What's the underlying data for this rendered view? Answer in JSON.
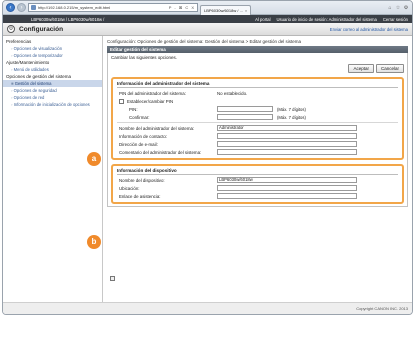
{
  "browser": {
    "back_icon": "back-arrow-icon",
    "forward_icon": "forward-arrow-icon",
    "url": "http://192.168.0.215/m_system_edit.html",
    "address_tools": "P - ⊠ C X",
    "tab_title": "LBP6030w/6018w / ...",
    "win_icons": [
      "⌂",
      "☆",
      "⚙"
    ]
  },
  "header": {
    "model": "LBP6030w/6018w / LBP6030w/6018w /",
    "portal_link": "Al portal",
    "login_text": "Usuario de inicio de sesión: Administrador del sistema",
    "logout_link": "Cerrar sesión"
  },
  "config_bar": {
    "title": "Configuración",
    "send_email": "Enviar correo al administrador del sistema"
  },
  "sidebar": {
    "groups": [
      {
        "title": "Preferencias",
        "items": [
          "Opciones de visualización",
          "Opciones de temporizador"
        ]
      },
      {
        "title": "Ajuste/Mantenimiento",
        "items": [
          "Menú de utilidades"
        ]
      },
      {
        "title": "Opciones de gestión del sistema",
        "items": [
          "Gestión del sistema",
          "Opciones de seguridad",
          "Opciones de red",
          "Información de inicialización de opciones"
        ]
      }
    ]
  },
  "main": {
    "breadcrumb": "Configuración: Opciones de gestión del sistema: Gestión del sistema > Editar gestión del sistema",
    "panel_title": "Editar gestión del sistema",
    "message": "Cambiar las siguientes opciones.",
    "accept_button": "Aceptar",
    "cancel_button": "Cancelar",
    "admin_section": {
      "title": "Información del administrador del sistema",
      "pin_label": "PIN del administrador del sistema:",
      "pin_value": "No establecido.",
      "set_pin_label": "Establecer/cambiar PIN",
      "pin_field_label": "PIN:",
      "pin_hint": "(Máx. 7 dígitos)",
      "confirm_label": "Confirmar:",
      "confirm_hint": "(Máx. 7 dígitos)",
      "admin_name_label": "Nombre del administrador del sistema:",
      "admin_name_value": "Administrator",
      "contact_label": "Información de contacto:",
      "email_label": "Dirección de e-mail:",
      "comment_label": "Comentario del administrador del sistema:"
    },
    "device_section": {
      "title": "Información del dispositivo",
      "device_name_label": "Nombre del dispositivo:",
      "device_name_value": "LBP6030w/6018w",
      "location_label": "Ubicación:",
      "support_label": "Enlace de asistencia:"
    },
    "badge_a": "a",
    "badge_b": "b"
  },
  "footer": {
    "copyright": "Copyright CANON INC. 2013"
  },
  "colors": {
    "accent_orange": "#f08a2b",
    "section_border": "#f2a649",
    "header_dark": "#3a3f46",
    "link_blue": "#2155a3"
  }
}
